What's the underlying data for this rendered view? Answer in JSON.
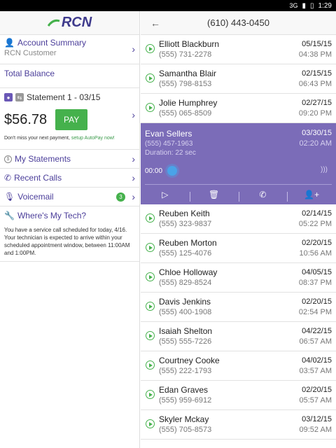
{
  "status": {
    "signal": "3G",
    "time": "1:29"
  },
  "left": {
    "logo": "RCN",
    "account": {
      "title": "Account Summary",
      "subtitle": "RCN Customer"
    },
    "total_balance_label": "Total Balance",
    "statement_label": "Statement 1 - 03/15",
    "amount": "$56.78",
    "pay_label": "PAY",
    "note_text": "Don't miss your next payment, ",
    "note_link": "setup AutoPay now!",
    "nav": [
      {
        "label": "My Statements"
      },
      {
        "label": "Recent Calls"
      },
      {
        "label": "Voicemail",
        "badge": "3"
      }
    ],
    "tech": {
      "title": "Where's My Tech?",
      "text": "You have a service call scheduled for today, 4/16. Your technician is expected to arrive within your scheduled appointment window, between 11:00AM and 1:00PM."
    }
  },
  "right": {
    "header_number": "(610) 443-0450",
    "voicemails_top": [
      {
        "name": "Elliott Blackburn",
        "phone": "(555) 731-2278",
        "date": "05/15/15",
        "time": "04:38 PM"
      },
      {
        "name": "Samantha Blair",
        "phone": "(555) 798-8153",
        "date": "02/15/15",
        "time": "06:43 PM"
      },
      {
        "name": "Jolie Humphrey",
        "phone": "(555) 065-8509",
        "date": "02/27/15",
        "time": "09:20 PM"
      }
    ],
    "active": {
      "name": "Evan Sellers",
      "phone": "(555) 457-1963",
      "duration": "Duration: 22 sec",
      "date": "03/30/15",
      "time": "02:20 AM",
      "elapsed": "00:00"
    },
    "voicemails_bottom": [
      {
        "name": "Reuben Keith",
        "phone": "(555) 323-9837",
        "date": "02/14/15",
        "time": "05:22 PM"
      },
      {
        "name": "Reuben Morton",
        "phone": "(555) 125-4076",
        "date": "02/20/15",
        "time": "10:56 AM"
      },
      {
        "name": "Chloe Holloway",
        "phone": "(555) 829-8524",
        "date": "04/05/15",
        "time": "08:37 PM"
      },
      {
        "name": "Davis Jenkins",
        "phone": "(555) 400-1908",
        "date": "02/20/15",
        "time": "02:54 PM"
      },
      {
        "name": "Isaiah Shelton",
        "phone": "(555) 555-7226",
        "date": "04/22/15",
        "time": "06:57 AM"
      },
      {
        "name": "Courtney Cooke",
        "phone": "(555) 222-1793",
        "date": "04/02/15",
        "time": "03:57 AM"
      },
      {
        "name": "Edan Graves",
        "phone": "(555) 959-6912",
        "date": "02/20/15",
        "time": "05:57 AM"
      },
      {
        "name": "Skyler Mckay",
        "phone": "(555) 705-8573",
        "date": "03/12/15",
        "time": "09:52 AM"
      }
    ]
  }
}
